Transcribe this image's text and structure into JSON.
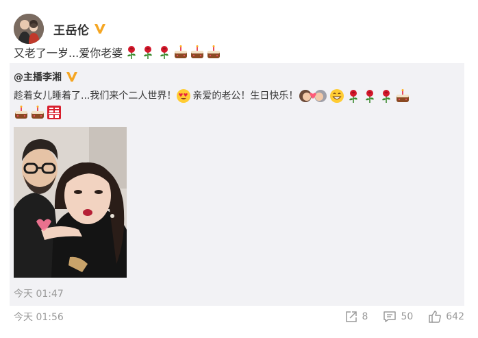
{
  "post": {
    "author": "王岳伦",
    "text": "又老了一岁...爱你老婆",
    "text_emojis": [
      "rose-icon",
      "rose-icon",
      "rose-icon",
      "cake-icon",
      "cake-icon",
      "cake-icon"
    ],
    "time": "今天 01:56"
  },
  "repost": {
    "author": "@主播李湘",
    "text_line1": "趁着女儿睡着了...我们来个二人世界！",
    "text_line1b": "亲爱的老公！生日快乐！",
    "line1_emojis_after": [
      "kiss-couple-icon",
      "grin-icon",
      "rose-icon",
      "rose-icon",
      "rose-icon",
      "cake-icon"
    ],
    "line2_emojis": [
      "cake-icon",
      "cake-icon",
      "double-happiness-icon"
    ],
    "time": "今天 01:47"
  },
  "actions": {
    "share_count": "8",
    "comment_count": "50",
    "like_count": "642"
  },
  "colors": {
    "verified": "#f5a623",
    "muted": "#999999",
    "repost_bg": "#f2f2f5"
  }
}
